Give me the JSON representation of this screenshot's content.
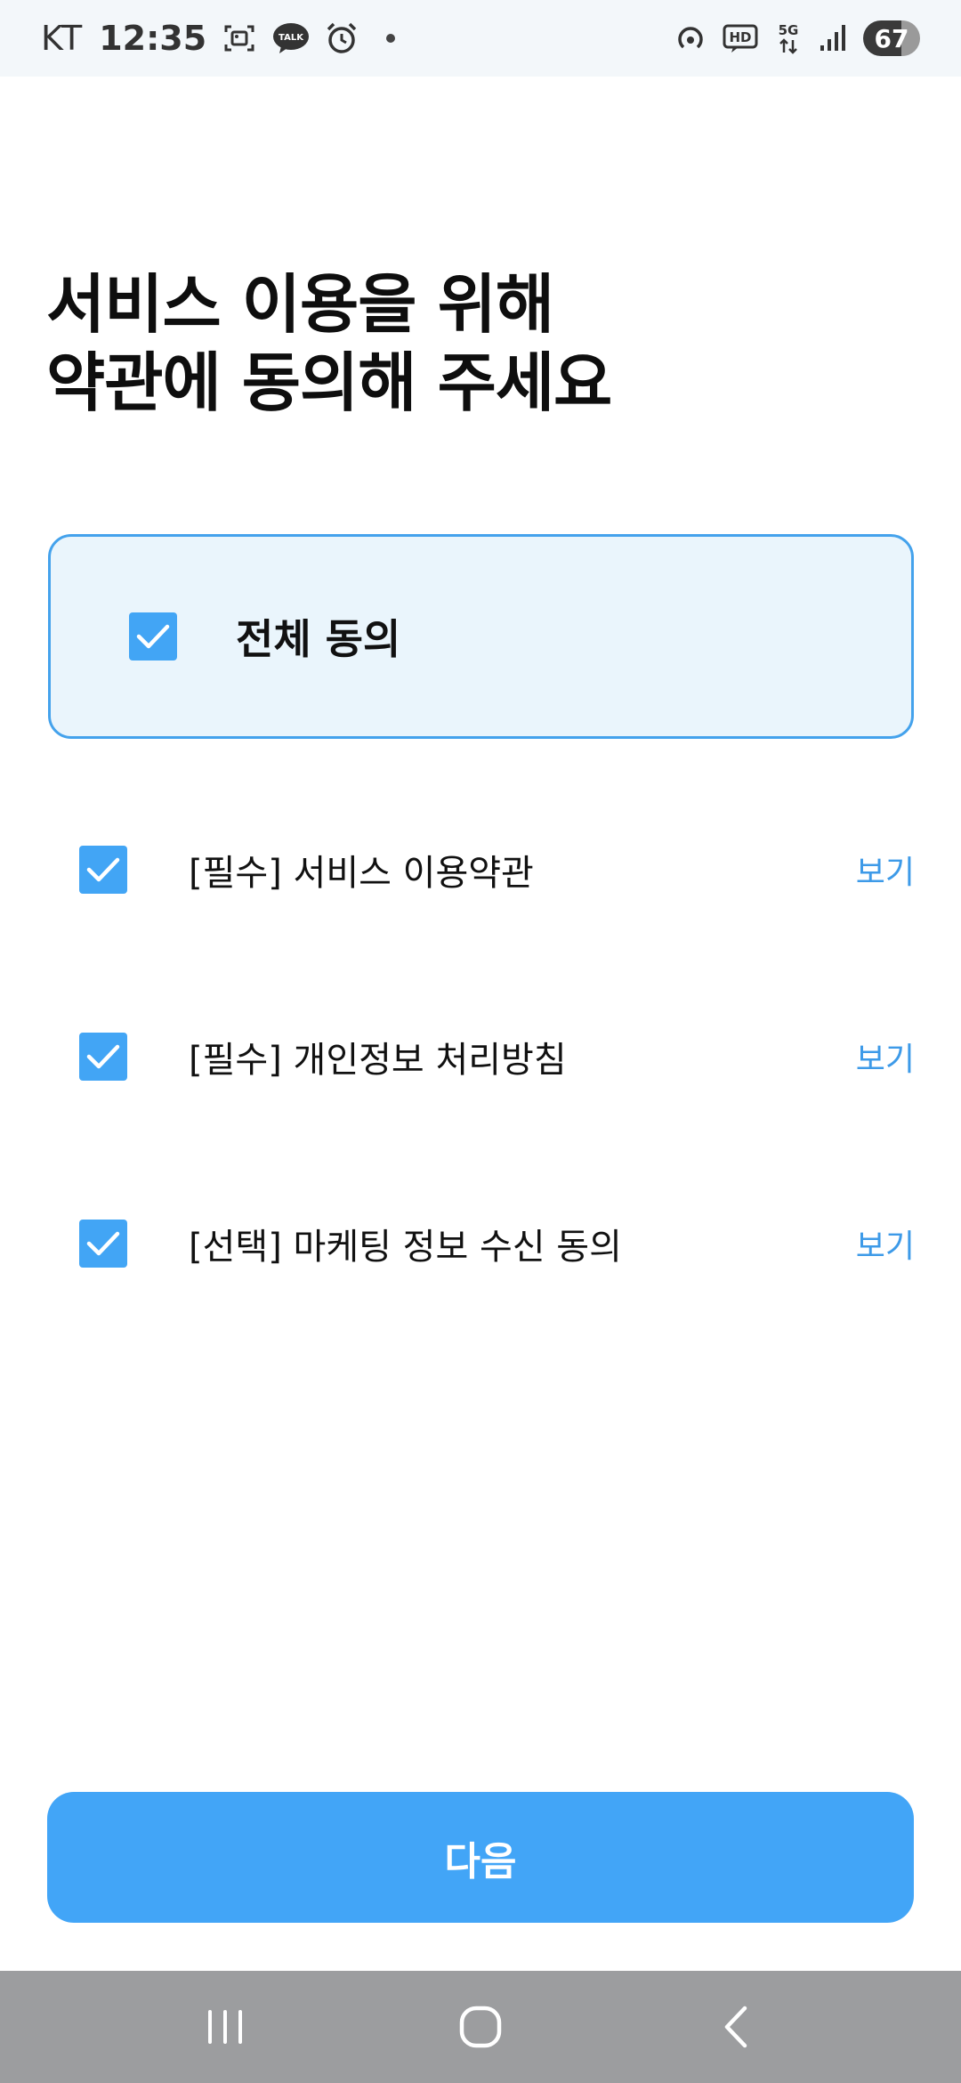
{
  "status_bar": {
    "carrier": "KT",
    "time": "12:35",
    "notification_icons": [
      "screenshot-icon",
      "kakaotalk-icon",
      "alarm-icon",
      "dot-icon"
    ],
    "system_icons": [
      "hotspot-icon",
      "hd-voice-icon",
      "5g-icon",
      "signal-icon"
    ],
    "talk_badge": "TALK",
    "hd_label": "HD",
    "network_label": "5G",
    "battery_level": "67"
  },
  "page": {
    "title_line1": "서비스 이용을 위해",
    "title_line2": "약관에 동의해 주세요"
  },
  "all_agree": {
    "label": "전체 동의",
    "checked": true
  },
  "terms": [
    {
      "label": "[필수] 서비스 이용약관",
      "view_label": "보기",
      "checked": true
    },
    {
      "label": "[필수] 개인정보 처리방침",
      "view_label": "보기",
      "checked": true
    },
    {
      "label": "[선택] 마케팅 정보 수신 동의",
      "view_label": "보기",
      "checked": true
    }
  ],
  "next_button": {
    "label": "다음"
  },
  "nav_bar": {
    "items": [
      "recent-apps-icon",
      "home-icon",
      "back-icon"
    ]
  },
  "colors": {
    "accent": "#42a5f5",
    "link": "#3d9ae8",
    "all_agree_bg": "#eaf5fc",
    "all_agree_border": "#44a2ec",
    "nav_bg": "#9c9d9f",
    "status_bg": "#f3f7fa"
  }
}
